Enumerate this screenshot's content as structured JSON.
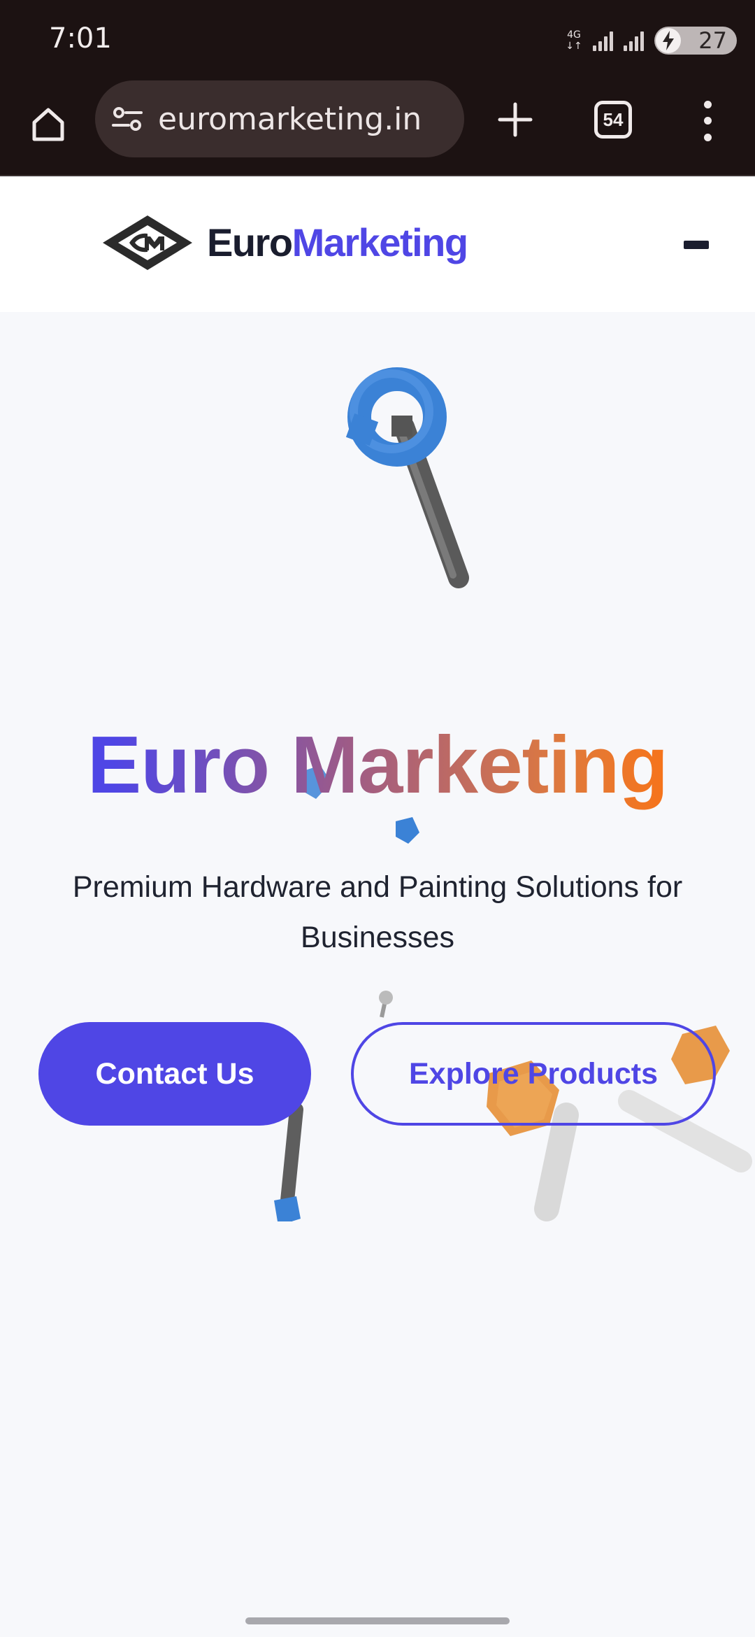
{
  "status_bar": {
    "time": "7:01",
    "network": "4G",
    "battery": "27"
  },
  "browser": {
    "url": "euromarketing.in",
    "tab_count": "54",
    "icons": [
      "home-icon",
      "site-settings-icon",
      "new-tab-plus-icon",
      "tab-switcher-icon",
      "more-vert-icon"
    ]
  },
  "header": {
    "brand_part1": "Euro",
    "brand_part2": "Marketing"
  },
  "hero": {
    "title": "Euro Marketing",
    "subtitle": "Premium Hardware and Painting Solutions for Businesses",
    "contact_label": "Contact Us",
    "explore_label": "Explore Products"
  },
  "colors": {
    "brand_primary": "#4f46e5",
    "brand_dark": "#1a1d2e",
    "gradient_end": "#f97316",
    "browser_chrome": "#1c1212",
    "page_bg": "#f7f8fb"
  }
}
